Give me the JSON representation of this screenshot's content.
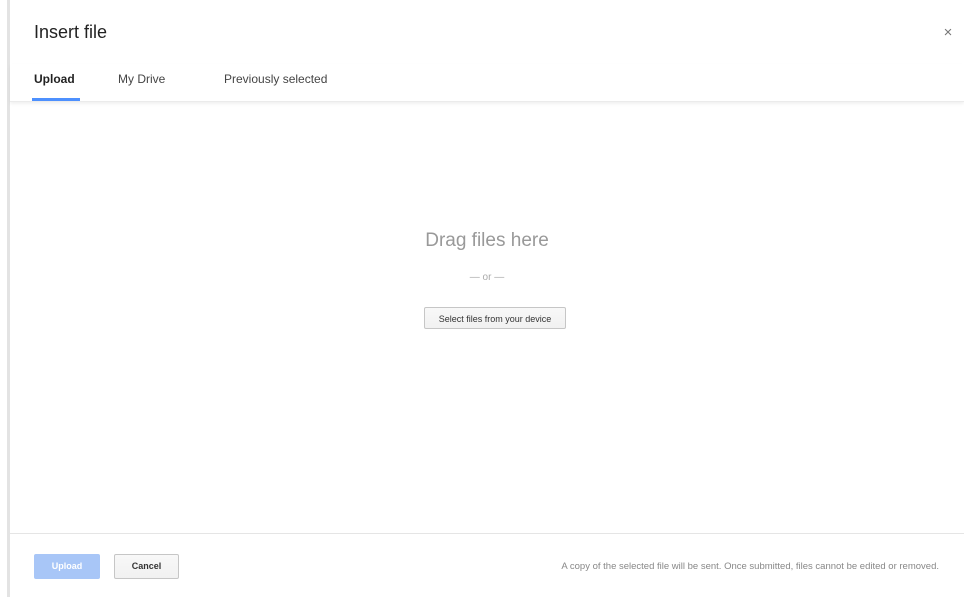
{
  "dialog": {
    "title": "Insert file",
    "close_glyph": "×",
    "close_icon": "close-icon"
  },
  "tabs": [
    {
      "label": "Upload",
      "active": true
    },
    {
      "label": "My Drive",
      "active": false
    },
    {
      "label": "Previously selected",
      "active": false
    }
  ],
  "upload_area": {
    "drag_text": "Drag files here",
    "or_text": "— or —",
    "select_button_label": "Select files from your device"
  },
  "footer": {
    "upload_label": "Upload",
    "cancel_label": "Cancel",
    "note": "A copy of the selected file will be sent. Once submitted, files cannot be edited or removed."
  },
  "colors": {
    "accent": "#4d90fe",
    "upload_disabled": "#a8c6f7"
  }
}
